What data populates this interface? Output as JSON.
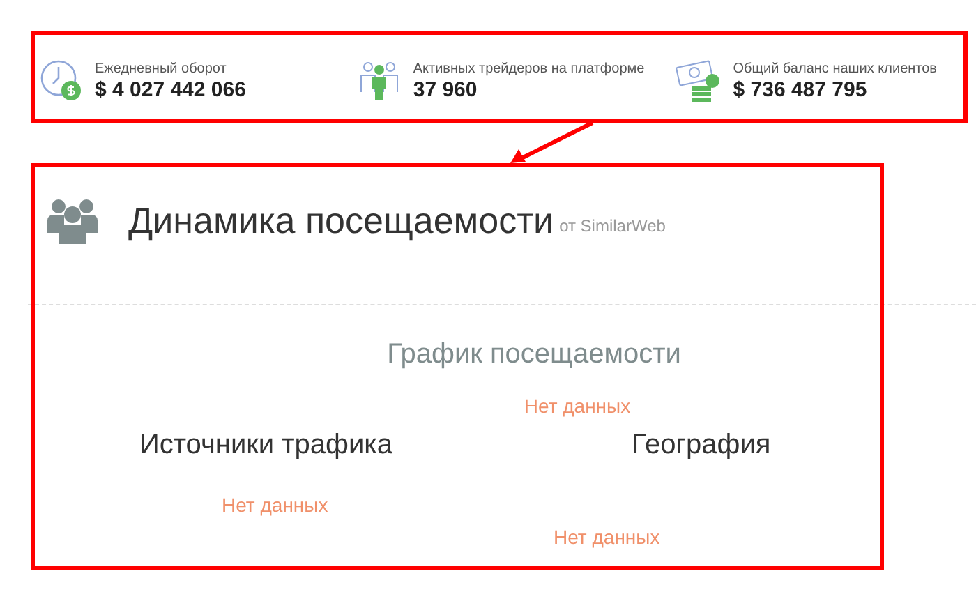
{
  "stats": [
    {
      "kind": "clock",
      "label": "Ежедневный оборот",
      "value": "$ 4 027 442 066"
    },
    {
      "kind": "people",
      "label": "Активных трейдеров на платформе",
      "value": "37 960"
    },
    {
      "kind": "money",
      "label": "Общий баланс наших клиентов",
      "value": "$ 736 487 795"
    }
  ],
  "section": {
    "title": "Динамика посещаемости",
    "source": "от SimilarWeb"
  },
  "traffic_chart": {
    "title": "График посещаемости",
    "status": "Нет данных"
  },
  "traffic_sources": {
    "title": "Источники трафика",
    "status": "Нет данных"
  },
  "geography": {
    "title": "География",
    "status": "Нет данных"
  }
}
